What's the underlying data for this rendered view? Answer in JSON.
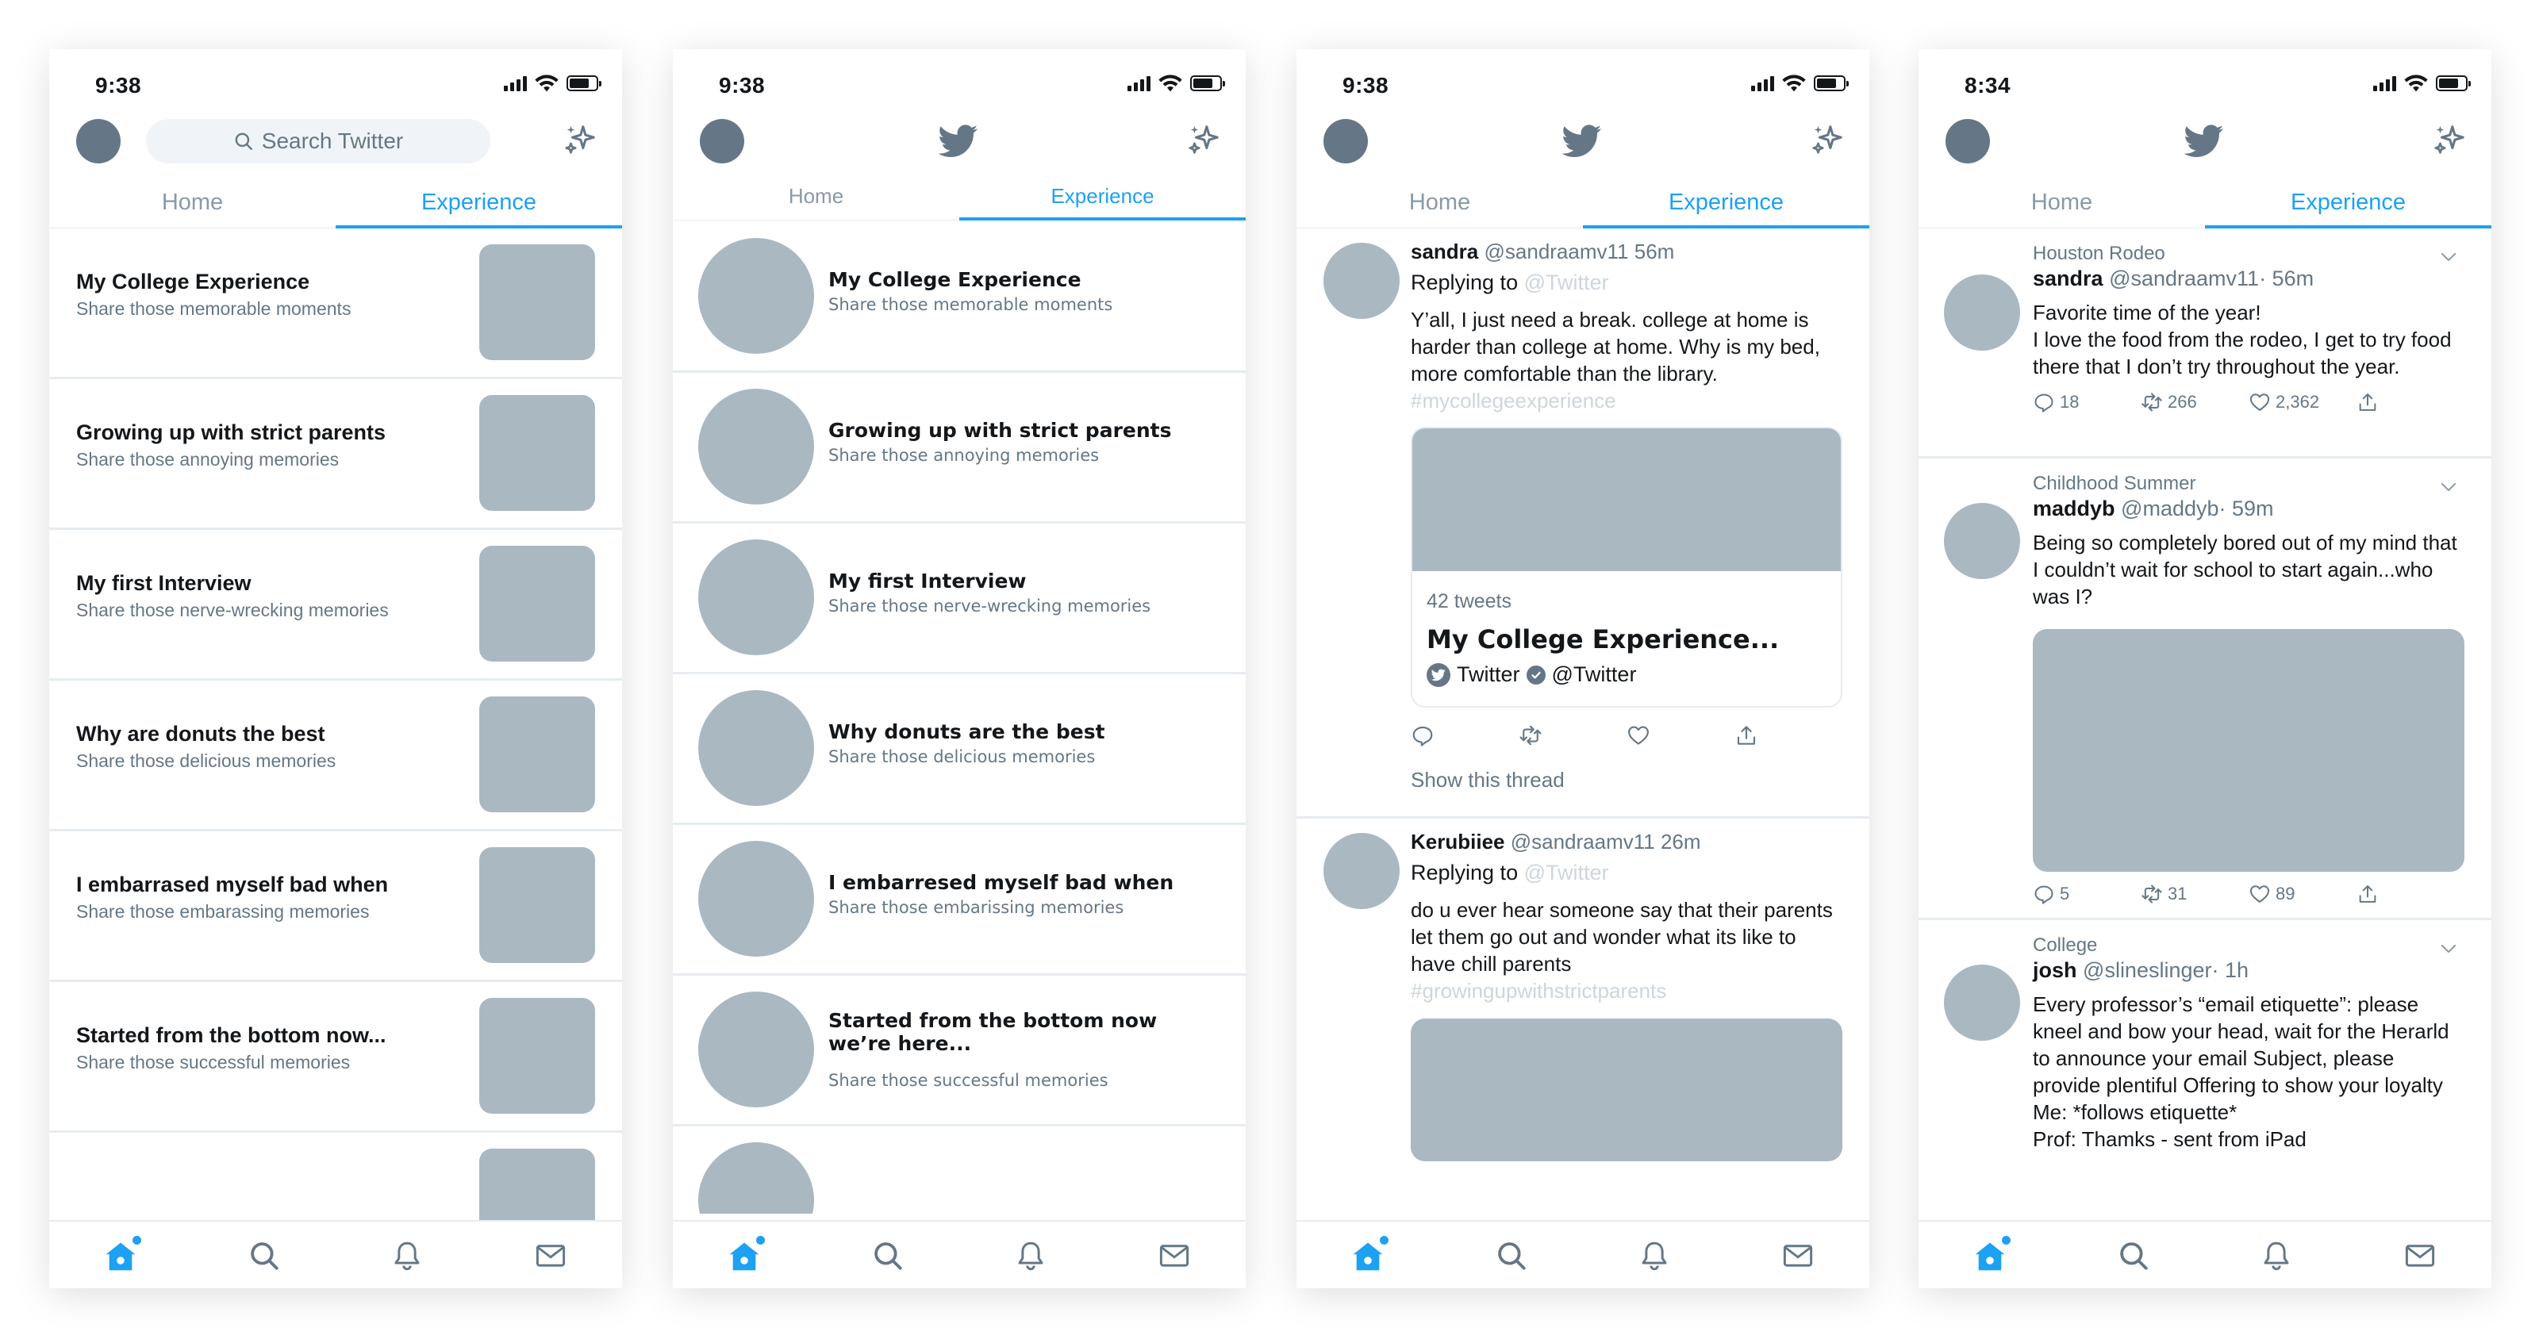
{
  "colors": {
    "accent": "#1da1f2",
    "placeholder": "#aab8c2",
    "muted": "#657786",
    "text": "#14171a"
  },
  "icons": {
    "home": "home-icon",
    "search": "search-icon",
    "notifications": "bell-icon",
    "messages": "mail-icon",
    "bird": "twitter-bird-icon",
    "sparkle": "sparkle-icon"
  },
  "screen1": {
    "time": "9:38",
    "search_placeholder": "Search Twitter",
    "tabs": [
      "Home",
      "Experience"
    ],
    "rows": [
      {
        "title": "My College Experience",
        "sub": "Share those memorable moments"
      },
      {
        "title": "Growing up with strict parents",
        "sub": "Share those annoying memories"
      },
      {
        "title": "My first Interview",
        "sub": "Share those nerve-wrecking memories"
      },
      {
        "title": "Why are donuts the best",
        "sub": "Share those delicious memories"
      },
      {
        "title": "I embarrased myself bad when",
        "sub": "Share those embarassing memories"
      },
      {
        "title": "Started from the bottom now...",
        "sub": "Share those successful memories"
      }
    ]
  },
  "screen2": {
    "time": "9:38",
    "tabs": [
      "Home",
      "Experience"
    ],
    "rows": [
      {
        "title": "My College Experience",
        "sub": "Share those memorable moments"
      },
      {
        "title": "Growing up with strict parents",
        "sub": "Share those annoying memories"
      },
      {
        "title": "My first Interview",
        "sub": "Share those nerve-wrecking memories"
      },
      {
        "title": "Why donuts are the best",
        "sub": "Share those delicious memories"
      },
      {
        "title": "I embarresed myself bad when",
        "sub": "Share those embarissing memories"
      },
      {
        "title": "Started from the bottom now we’re here...",
        "sub": "Share those successful memories"
      }
    ]
  },
  "screen3": {
    "time": "9:38",
    "tabs": [
      "Home",
      "Experience"
    ],
    "tweets": [
      {
        "name": "sandra",
        "handle": "@sandraamv11",
        "time": "56m",
        "replying_prefix": "Replying to",
        "replying_to": "@Twitter",
        "text": "Y’all, I just need a break. college at home is harder than college at home. Why is my bed, more comfortable than the library.",
        "hashtag": "#mycollegeexperience",
        "card": {
          "count": "42 tweets",
          "title": "My College Experience...",
          "author": "Twitter",
          "author_handle": "@Twitter"
        },
        "show_thread": "Show this thread"
      },
      {
        "name": "Kerubiiee",
        "handle": "@sandraamv11",
        "time": "26m",
        "replying_prefix": "Replying to",
        "replying_to": "@Twitter",
        "text": "do u ever hear someone say that their parents let them go out and wonder what its like to have chill parents",
        "hashtag": "#growingupwithstrictparents"
      }
    ]
  },
  "screen4": {
    "time": "8:34",
    "tabs": [
      "Home",
      "Experience"
    ],
    "tweets": [
      {
        "context": "Houston Rodeo",
        "name": "sandra",
        "handle": "@sandraamv11",
        "time": "· 56m",
        "text_line1": "Favorite time of the year!",
        "text": "I love the food from the rodeo, I get to try food there that I don’t try throughout the year.",
        "replies": "18",
        "retweets": "266",
        "likes": "2,362"
      },
      {
        "context": "Childhood Summer",
        "name": "maddyb",
        "handle": "@maddyb",
        "time": "· 59m",
        "text": "Being so completely bored out of my mind that I couldn’t wait for school to start again...who was I?",
        "replies": "5",
        "retweets": "31",
        "likes": "89"
      },
      {
        "context": "College",
        "name": "josh",
        "handle": "@slineslinger",
        "time": "· 1h",
        "text": "Every professor’s “email etiquette”: please kneel and bow your head, wait for the Herarld to announce your email Subject, please provide plentiful Offering to show your loyalty",
        "text_line2": "Me: *follows etiquette*",
        "text_line3": "Prof: Thamks - sent from iPad"
      }
    ]
  }
}
